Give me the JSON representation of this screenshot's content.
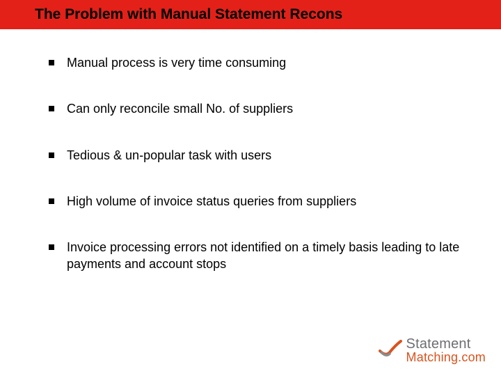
{
  "title": "The Problem with Manual Statement Recons",
  "bullets": [
    "Manual process is very time consuming",
    "Can only reconcile small No. of suppliers",
    "Tedious & un-popular task with users",
    "High volume of invoice status queries from suppliers",
    "Invoice processing errors not identified on a timely basis leading to late payments and account stops"
  ],
  "logo": {
    "line1": "Statement",
    "line2": "Matching.com"
  },
  "colors": {
    "header_bg": "#e32119",
    "logo_gray": "#6d6e71",
    "logo_orange": "#d9531e"
  }
}
